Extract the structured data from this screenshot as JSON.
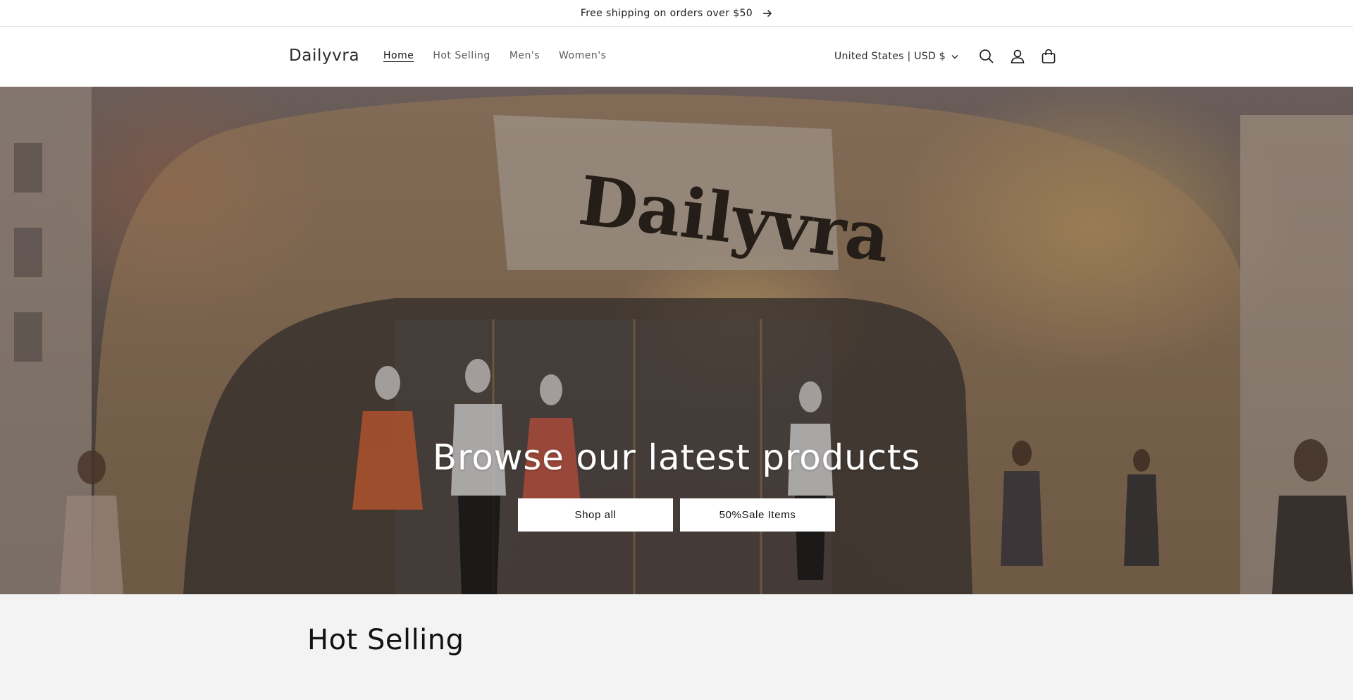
{
  "announcement": {
    "text": "Free shipping on orders over $50",
    "icon": "arrow-right-icon"
  },
  "header": {
    "logo": "Dailyvra",
    "nav": [
      {
        "label": "Home",
        "active": true
      },
      {
        "label": "Hot Selling",
        "active": false
      },
      {
        "label": "Men's",
        "active": false
      },
      {
        "label": "Women's",
        "active": false
      }
    ],
    "locale": "United States | USD $",
    "icons": [
      "chevron-down-icon",
      "search-icon",
      "account-icon",
      "cart-icon"
    ]
  },
  "hero": {
    "sign_text": "Dailyvra",
    "heading": "Browse our latest products",
    "buttons": [
      "Shop all",
      "50%Sale Items"
    ]
  },
  "section": {
    "title": "Hot Selling"
  },
  "colors": {
    "text": "#121212",
    "nav_inactive": "#5a5a5a",
    "section_bg": "#f3f3f3",
    "button_bg": "#ffffff"
  }
}
